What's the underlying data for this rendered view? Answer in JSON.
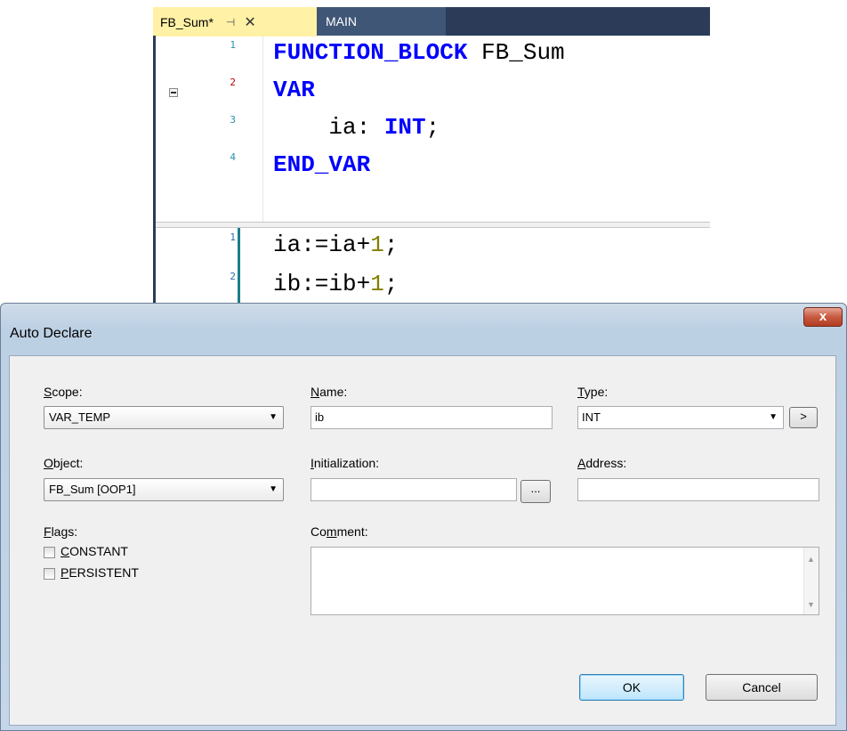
{
  "editor": {
    "tabs": [
      {
        "label": "FB_Sum*",
        "pin_icon": "pin-icon",
        "close_icon": "close-icon"
      },
      {
        "label": "MAIN"
      }
    ],
    "declaration_lines": [
      {
        "number": "1",
        "tokens": [
          {
            "text": "FUNCTION_BLOCK",
            "kind": "kw"
          },
          {
            "text": " FB_Sum",
            "kind": "plain"
          }
        ]
      },
      {
        "number": "2",
        "tokens": [
          {
            "text": "VAR",
            "kind": "kw"
          }
        ]
      },
      {
        "number": "3",
        "tokens": [
          {
            "text": "    ia: ",
            "kind": "plain"
          },
          {
            "text": "INT",
            "kind": "kw"
          },
          {
            "text": ";",
            "kind": "plain"
          }
        ]
      },
      {
        "number": "4",
        "tokens": [
          {
            "text": "END_VAR",
            "kind": "kw"
          }
        ]
      }
    ],
    "implementation_lines": [
      {
        "number": "1",
        "tokens": [
          {
            "text": "ia:=ia+",
            "kind": "plain"
          },
          {
            "text": "1",
            "kind": "num"
          },
          {
            "text": ";",
            "kind": "plain"
          }
        ]
      },
      {
        "number": "2",
        "tokens": [
          {
            "text": "ib:=ib+",
            "kind": "plain"
          },
          {
            "text": "1",
            "kind": "num"
          },
          {
            "text": ";",
            "kind": "plain"
          }
        ]
      }
    ]
  },
  "dialog": {
    "title": "Auto Declare",
    "close_label": "x",
    "scope": {
      "label_pre": "",
      "label_u": "S",
      "label_post": "cope:",
      "value": "VAR_TEMP"
    },
    "name": {
      "label_pre": "",
      "label_u": "N",
      "label_post": "ame:",
      "value": "ib"
    },
    "type": {
      "label_pre": "",
      "label_u": "T",
      "label_post": "ype:",
      "value": "INT",
      "browse_label": ">"
    },
    "object": {
      "label_pre": "",
      "label_u": "O",
      "label_post": "bject:",
      "value": "FB_Sum [OOP1]"
    },
    "initialization": {
      "label_pre": "",
      "label_u": "I",
      "label_post": "nitialization:",
      "value": "",
      "button_label": "..."
    },
    "address": {
      "label_pre": "",
      "label_u": "A",
      "label_post": "ddress:",
      "value": ""
    },
    "flags": {
      "label_pre": "",
      "label_u": "F",
      "label_post": "lags:",
      "items": [
        {
          "label_pre": "",
          "label_u": "C",
          "label_post": "ONSTANT",
          "checked": false
        },
        {
          "label_pre": "",
          "label_u": "P",
          "label_post": "ERSISTENT",
          "checked": false
        }
      ]
    },
    "comment": {
      "label_pre": "Co",
      "label_u": "m",
      "label_post": "ment:",
      "value": ""
    },
    "ok_label": "OK",
    "cancel_label": "Cancel"
  }
}
